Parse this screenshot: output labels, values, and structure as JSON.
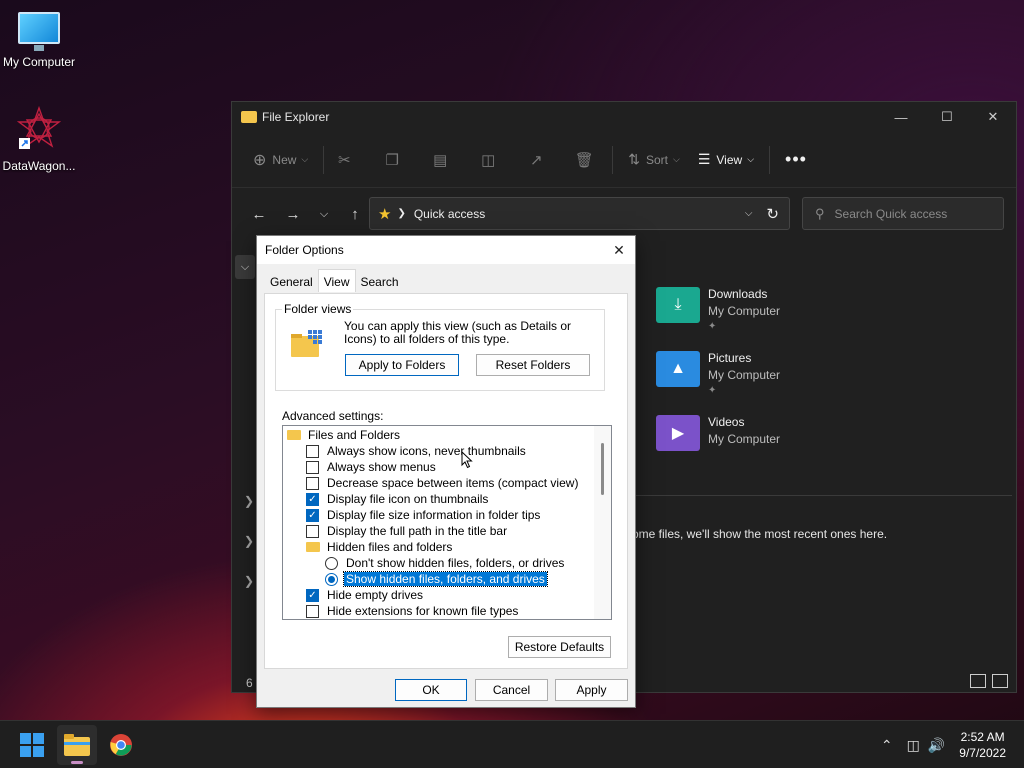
{
  "desktop": {
    "icons": [
      {
        "label": "My Computer",
        "icon": "monitor-icon"
      },
      {
        "label": "DataWagon...",
        "icon": "datawagon-logo-icon"
      }
    ]
  },
  "explorer": {
    "title": "File Explorer",
    "toolbar": {
      "new_label": "New",
      "sort_label": "Sort",
      "view_label": "View"
    },
    "address": {
      "location": "Quick access"
    },
    "search_placeholder": "Search Quick access",
    "quick_access": [
      {
        "name": "Downloads",
        "location": "My Computer",
        "color": "#1aa890"
      },
      {
        "name": "Pictures",
        "location": "My Computer",
        "color": "#2a8be0"
      },
      {
        "name": "Videos",
        "location": "My Computer",
        "color": "#7b52c9"
      }
    ],
    "recent_message": "ome files, we'll show the most recent ones here.",
    "status_count": "6"
  },
  "dialog": {
    "title": "Folder Options",
    "tabs": [
      "General",
      "View",
      "Search"
    ],
    "active_tab": "View",
    "folder_views": {
      "group_label": "Folder views",
      "description": "You can apply this view (such as Details or Icons) to all folders of this type.",
      "apply_button": "Apply to Folders",
      "reset_button": "Reset Folders"
    },
    "advanced_label": "Advanced settings:",
    "advanced_items": [
      {
        "type": "folder",
        "label": "Files and Folders"
      },
      {
        "type": "checkbox",
        "label": "Always show icons, never thumbnails",
        "checked": false
      },
      {
        "type": "checkbox",
        "label": "Always show menus",
        "checked": false
      },
      {
        "type": "checkbox",
        "label": "Decrease space between items (compact view)",
        "checked": false
      },
      {
        "type": "checkbox",
        "label": "Display file icon on thumbnails",
        "checked": true
      },
      {
        "type": "checkbox",
        "label": "Display file size information in folder tips",
        "checked": true
      },
      {
        "type": "checkbox",
        "label": "Display the full path in the title bar",
        "checked": false
      },
      {
        "type": "folder",
        "label": "Hidden files and folders"
      },
      {
        "type": "radio",
        "label": "Don't show hidden files, folders, or drives",
        "checked": false
      },
      {
        "type": "radio",
        "label": "Show hidden files, folders, and drives",
        "checked": true
      },
      {
        "type": "checkbox",
        "label": "Hide empty drives",
        "checked": true
      },
      {
        "type": "checkbox",
        "label": "Hide extensions for known file types",
        "checked": false
      }
    ],
    "restore_button": "Restore Defaults",
    "ok_button": "OK",
    "cancel_button": "Cancel",
    "apply_button": "Apply"
  },
  "taskbar": {
    "time": "2:52 AM",
    "date": "9/7/2022"
  }
}
